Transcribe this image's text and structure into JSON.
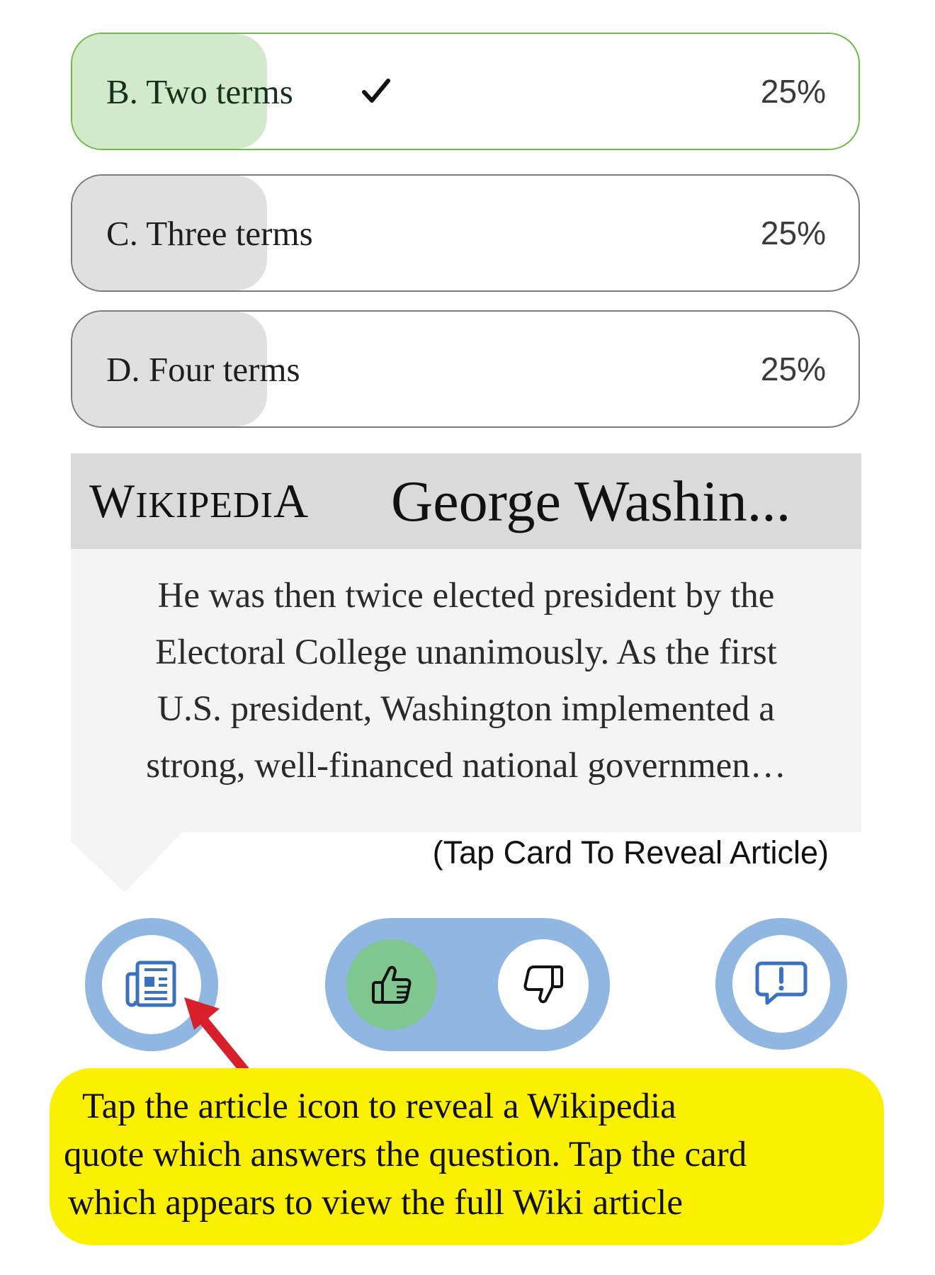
{
  "options": [
    {
      "label": "B. Two terms",
      "percent_text": "25%",
      "fill": 0.25,
      "correct": true
    },
    {
      "label": "C. Three terms",
      "percent_text": "25%",
      "fill": 0.25,
      "correct": false
    },
    {
      "label": "D. Four terms",
      "percent_text": "25%",
      "fill": 0.25,
      "correct": false
    }
  ],
  "wiki": {
    "logo": {
      "first": "W",
      "small1": "IKIPEDI",
      "last": "A"
    },
    "title": "George Washin...",
    "excerpt_lines": [
      "He was then twice elected president by the",
      "Electoral College unanimously. As the first",
      "U.S. president, Washington implemented a",
      "strong, well-financed national governmen…"
    ],
    "hint": "(Tap Card To Reveal Article)"
  },
  "actions": {
    "article_icon": "newspaper-icon",
    "like_icon": "thumbs-up-icon",
    "dislike_icon": "thumbs-down-icon",
    "report_icon": "report-bubble-icon"
  },
  "tip": {
    "lines": [
      "Tap the article icon to reveal a Wikipedia",
      "quote which answers the question. Tap the card",
      "which appears to view the full Wiki article"
    ]
  },
  "colors": {
    "correct_border": "#6cbc48",
    "correct_fill": "#d3e9cb",
    "option_fill": "#e0e0e0",
    "button_ring": "#8fb7e2",
    "like_active": "#7fc691",
    "icon_blue": "#3a72c0",
    "arrow_red": "#d8202a",
    "tip_background": "#fbf000"
  }
}
